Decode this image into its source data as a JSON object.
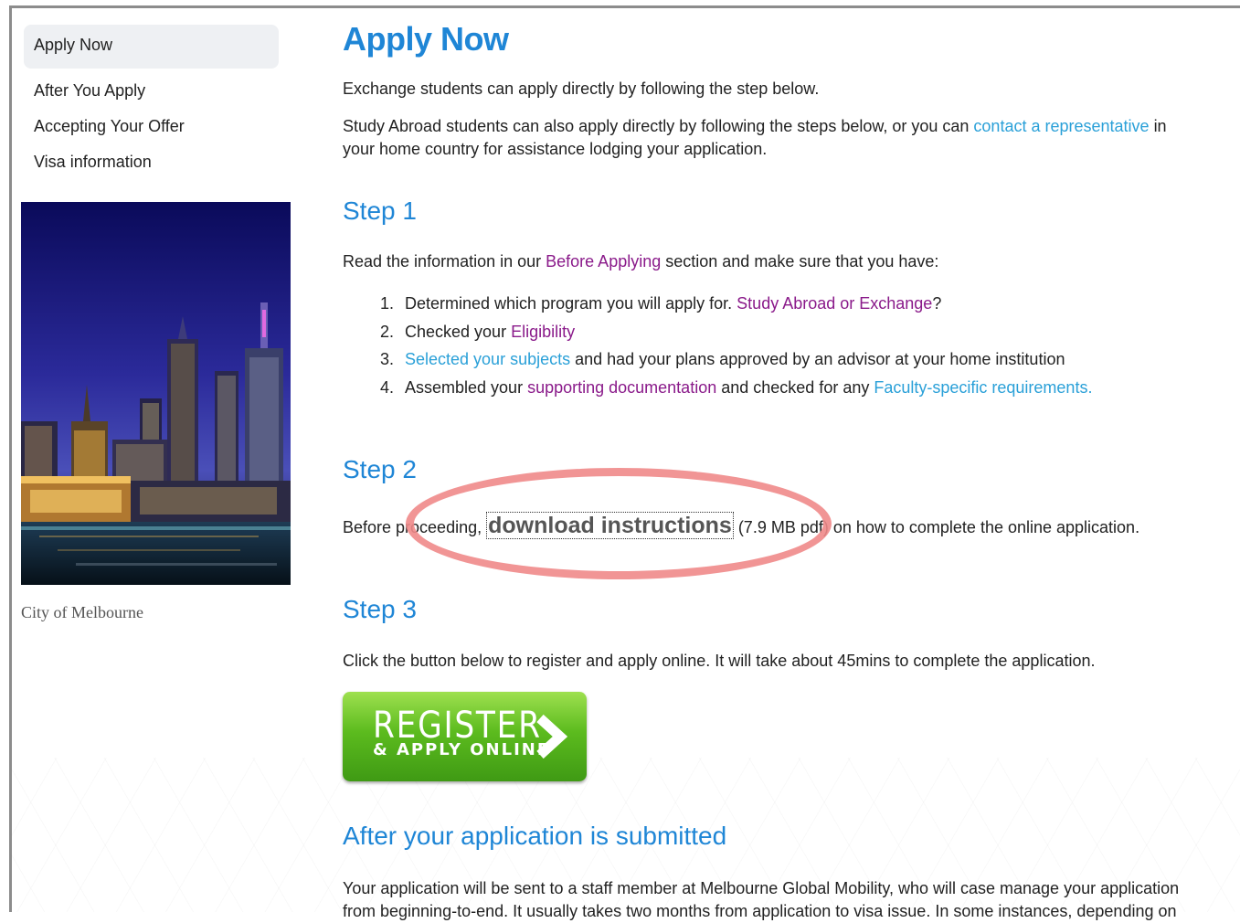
{
  "sidebar": {
    "items": [
      {
        "label": "Apply Now",
        "active": true
      },
      {
        "label": "After You Apply"
      },
      {
        "label": "Accepting Your Offer"
      },
      {
        "label": "Visa information"
      }
    ],
    "image_caption": "City of Melbourne"
  },
  "main": {
    "title": "Apply Now",
    "intro_1": "Exchange students can apply directly by following the step below.",
    "intro_2a": "Study Abroad students can also apply directly by following the steps below, or you can",
    "intro_2_link": "contact a representative",
    "intro_2b": "in",
    "intro_2c": "your home country for assistance lodging your application.",
    "step1": {
      "heading": "Step 1",
      "text_a": "Read the information in our",
      "link": "Before Applying",
      "text_b": "section and make sure that you have:",
      "list": [
        {
          "num": "1.",
          "a": "Determined which program you will apply for.",
          "link": "Study Abroad or Exchange",
          "b": "?"
        },
        {
          "num": "2.",
          "a": "Checked your",
          "link": "Eligibility"
        },
        {
          "num": "3.",
          "link": "Selected your subjects",
          "b": "and had your plans approved by an advisor at your home institution"
        },
        {
          "num": "4.",
          "a": "Assembled your",
          "link": "supporting documentation",
          "b": "and checked for any",
          "link2": "Faculty-specific requirements",
          "c": "."
        }
      ]
    },
    "step2": {
      "heading": "Step 2",
      "text_a": "Before proceeding,",
      "link": "download instructions",
      "text_b": "(7.9 MB pdf) on how to complete the online application."
    },
    "step3": {
      "heading": "Step 3",
      "text": "Click the button below to register and apply online. It will take about 45mins to complete the application.",
      "button_big": "REGISTER",
      "button_small": "& APPLY ONLINE"
    },
    "after": {
      "heading": "After your application is submitted",
      "text_1": "Your application will be sent to a staff member at Melbourne Global Mobility, who will case manage your application",
      "text_2": "from beginning-to-end. It usually takes two months from application to visa issue. In some instances, depending on"
    }
  },
  "colors": {
    "accent": "#1f86d6",
    "link_blue": "#2aa0d8",
    "link_visited": "#8a1a8a",
    "highlight_circle": "#f08a8a"
  }
}
